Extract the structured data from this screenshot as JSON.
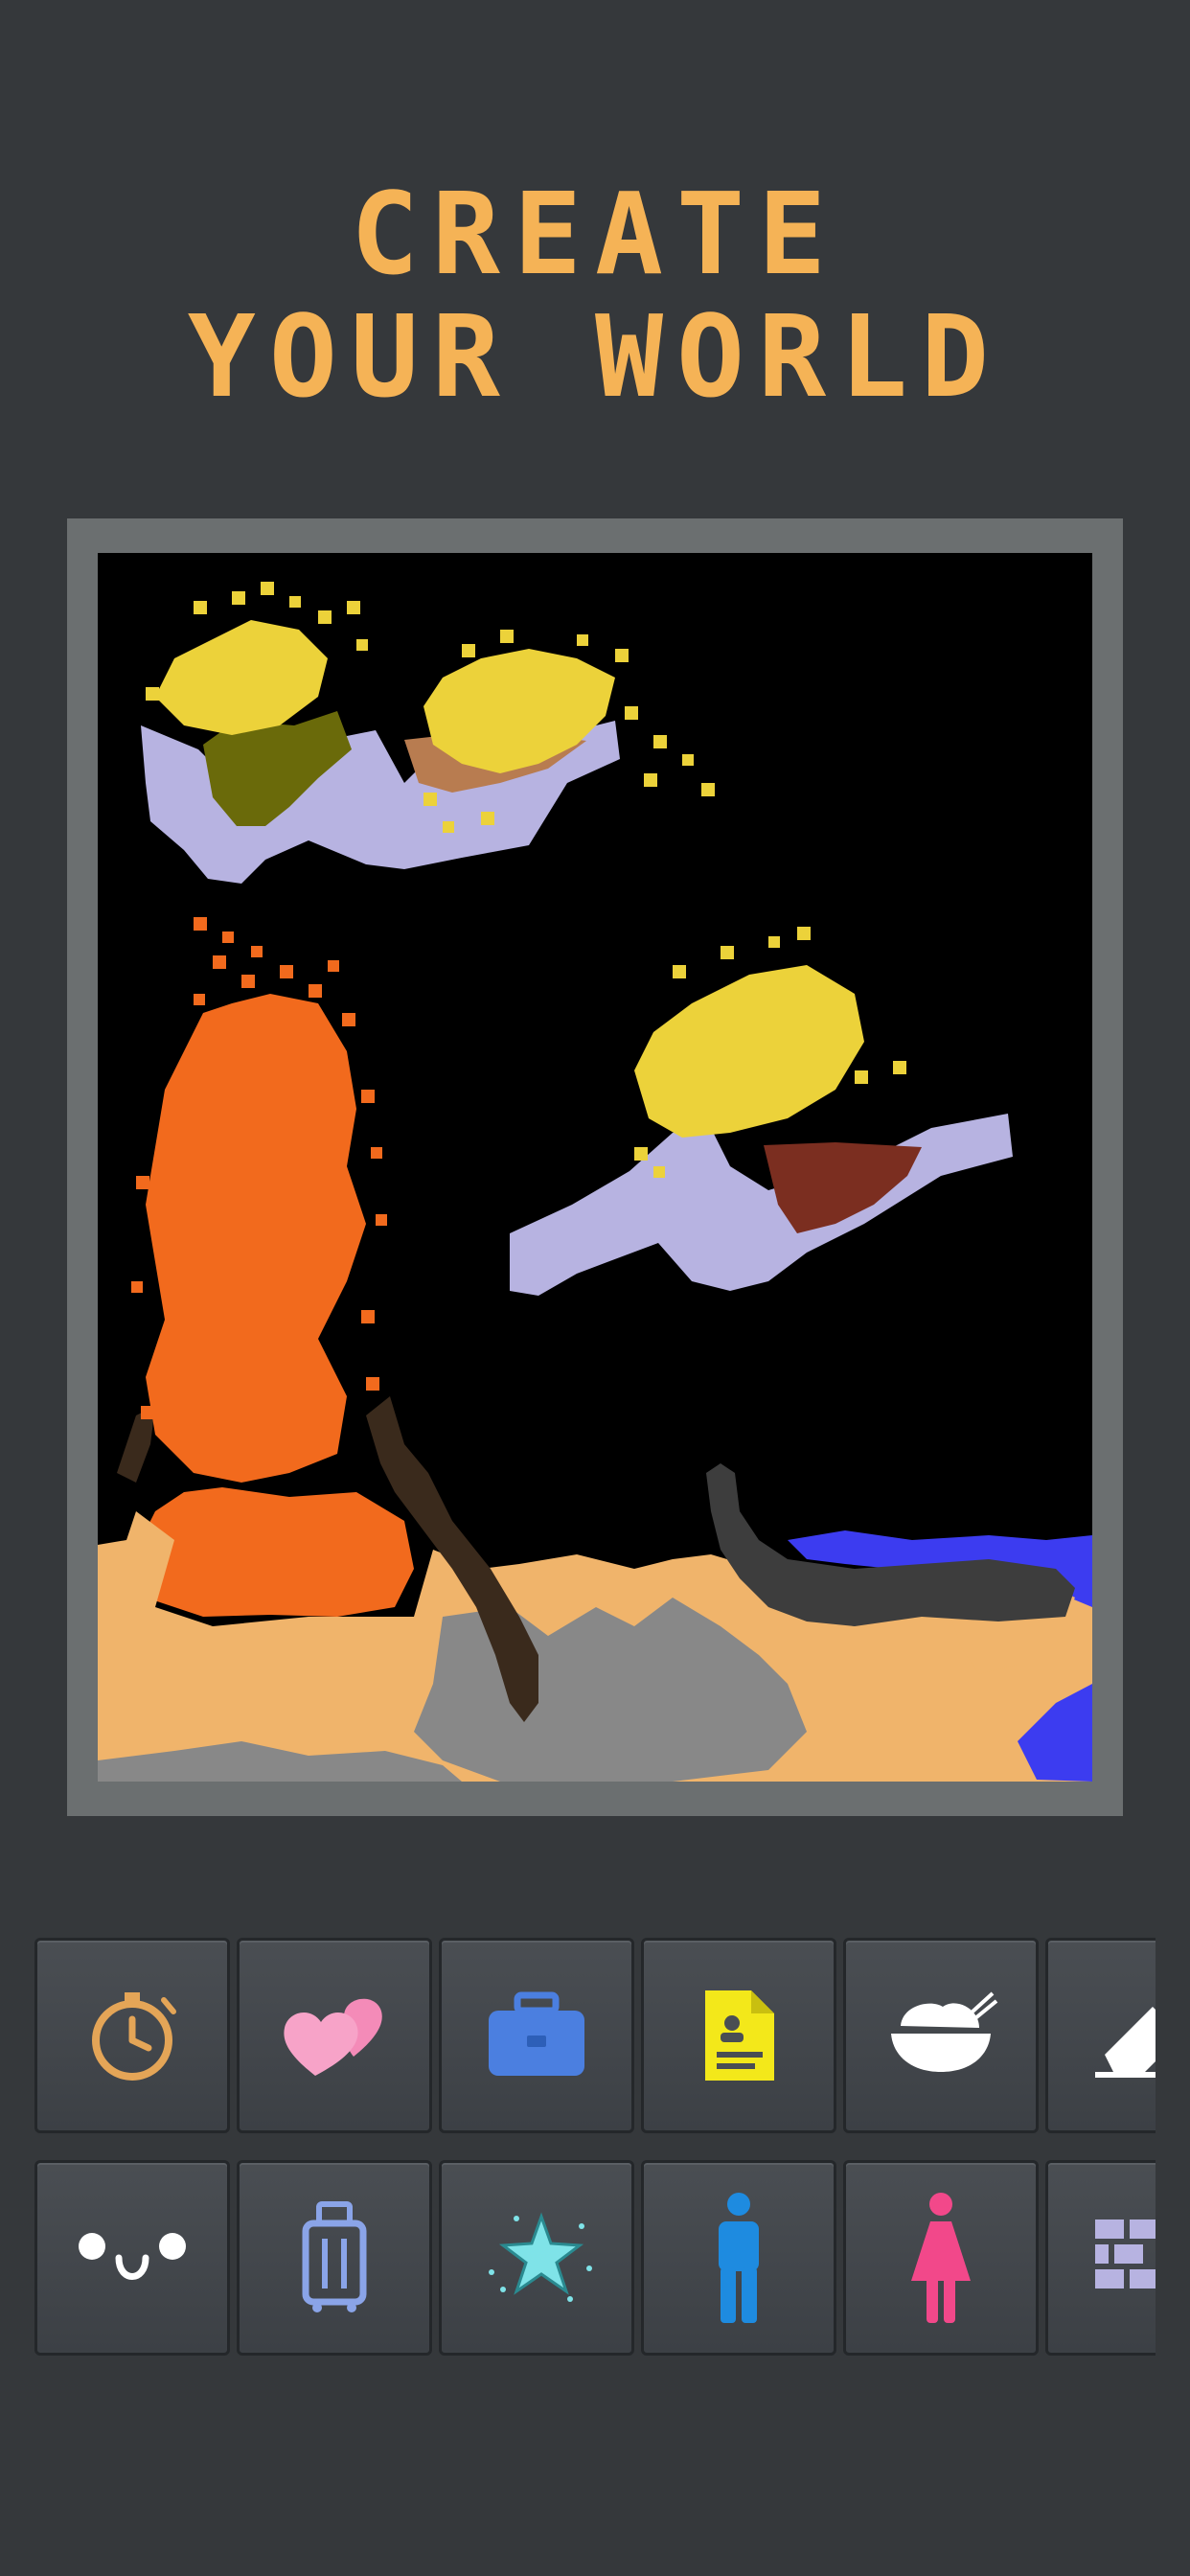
{
  "header": {
    "title_line1": "CREATE",
    "title_line2": "YOUR WORLD",
    "title_color": "#f5b356"
  },
  "canvas": {
    "background": "#000000",
    "frame_color": "#6b6f70",
    "materials_shown": [
      "sand",
      "fire",
      "water",
      "stone",
      "wood",
      "cloud",
      "spark",
      "mud",
      "dirt"
    ]
  },
  "toolbar": {
    "row1": [
      {
        "icon": "stopwatch-icon"
      },
      {
        "icon": "hearts-icon"
      },
      {
        "icon": "briefcase-icon"
      },
      {
        "icon": "document-icon"
      },
      {
        "icon": "rice-bowl-icon"
      },
      {
        "icon": "eraser-icon"
      }
    ],
    "row2": [
      {
        "icon": "face-icon"
      },
      {
        "icon": "luggage-icon"
      },
      {
        "icon": "star-icon"
      },
      {
        "icon": "man-icon"
      },
      {
        "icon": "woman-icon"
      },
      {
        "icon": "brick-wall-icon"
      }
    ]
  }
}
